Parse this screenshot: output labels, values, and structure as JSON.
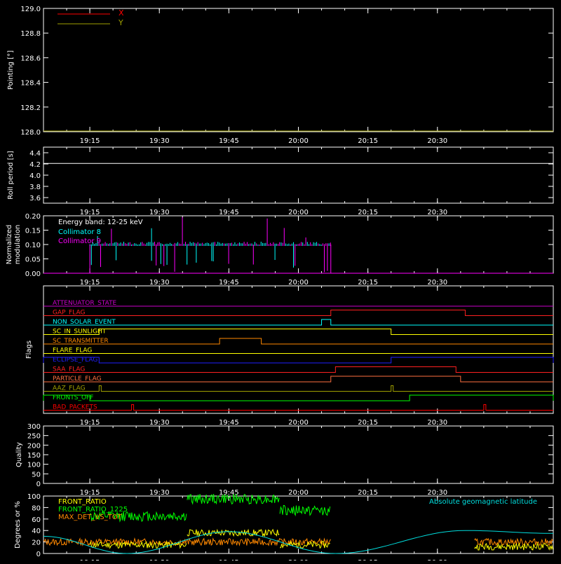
{
  "colors": {
    "background": "#000000",
    "axes": "#ffffff",
    "x": "#ff0000",
    "y": "#a0a000",
    "roll": "#ffffff",
    "collimator8": "#00ffff",
    "collimator9": "#ff00ff",
    "front_ratio": "#ffff00",
    "front_ratio_1225": "#00ff00",
    "max_det": "#ff8800",
    "geomag": "#00dddd"
  },
  "time_ticks": [
    "19:15",
    "19:30",
    "19:45",
    "20:00",
    "20:15",
    "20:30"
  ],
  "chart_data": [
    {
      "type": "line",
      "panel": "pointing",
      "ylabel": "Pointing [°]",
      "ylim": [
        128.0,
        129.0
      ],
      "yticks": [
        "128.0",
        "128.2",
        "128.4",
        "128.6",
        "128.8",
        "129.0"
      ],
      "legend": "top-left",
      "series": [
        {
          "name": "X",
          "values": []
        },
        {
          "name": "Y",
          "values": []
        }
      ]
    },
    {
      "type": "line",
      "panel": "roll",
      "ylabel": "Roll period [s]",
      "ylim": [
        3.5,
        4.5
      ],
      "yticks": [
        "3.6",
        "3.8",
        "4.0",
        "4.2",
        "4.4"
      ],
      "series": [
        {
          "name": "",
          "x": [
            "19:05",
            "20:55"
          ],
          "values": [
            4.21,
            4.21
          ]
        }
      ]
    },
    {
      "type": "line",
      "panel": "modulation",
      "ylabel": "Normalized modulation",
      "ylim": [
        0.0,
        0.2
      ],
      "yticks": [
        "0.00",
        "0.05",
        "0.10",
        "0.15",
        "0.20"
      ],
      "annotation": "Energy band: 12-25 keV",
      "active_range": [
        "19:15",
        "20:07"
      ],
      "series": [
        {
          "name": "Collimator 8",
          "level": 0.1
        },
        {
          "name": "Collimator 9",
          "level": 0.1
        }
      ]
    },
    {
      "type": "line",
      "panel": "flags",
      "ylabel": "Flags",
      "flags": [
        {
          "name": "ATTENUATOR_STATE",
          "color": "#cc00cc",
          "high": []
        },
        {
          "name": "GAP_FLAG",
          "color": "#ff2020",
          "high": [
            [
              "20:07",
              "20:36"
            ]
          ]
        },
        {
          "name": "NON_SOLAR_EVENT",
          "color": "#00ffff",
          "high": [
            [
              "20:05",
              "20:07"
            ]
          ]
        },
        {
          "name": "SC_IN_SUNLIGHT",
          "color": "#ffff00",
          "high": [
            [
              "19:17",
              "20:20"
            ]
          ]
        },
        {
          "name": "SC_TRANSMITTER",
          "color": "#ff8800",
          "high": [
            [
              "19:43",
              "19:52"
            ]
          ]
        },
        {
          "name": "FLARE_FLAG",
          "color": "#ffff00",
          "high": []
        },
        {
          "name": "ECLIPSE_FLAG",
          "color": "#2020ff",
          "high": [
            [
              "19:05",
              "19:17"
            ],
            [
              "20:20",
              "20:55"
            ]
          ]
        },
        {
          "name": "SAA_FLAG",
          "color": "#ff2020",
          "high": [
            [
              "20:08",
              "20:34"
            ]
          ]
        },
        {
          "name": "PARTICLE_FLAG",
          "color": "#ff7040",
          "high": [
            [
              "20:07",
              "20:35"
            ]
          ]
        },
        {
          "name": "AAZ_FLAG",
          "color": "#a0a000",
          "high": [
            [
              "19:17",
              "19:17"
            ],
            [
              "20:20",
              "20:20"
            ]
          ]
        },
        {
          "name": "FRONTS_OFF",
          "color": "#00ff00",
          "high": [
            [
              "19:05",
              "19:15"
            ],
            [
              "20:24",
              "20:55"
            ]
          ]
        },
        {
          "name": "BAD_PACKETS",
          "color": "#ff0000",
          "high": [
            [
              "19:24",
              "19:24"
            ],
            [
              "20:40",
              "20:40"
            ]
          ]
        }
      ]
    },
    {
      "type": "line",
      "panel": "quality",
      "ylabel": "Quality",
      "ylim": [
        0,
        300
      ],
      "yticks": [
        "0",
        "50",
        "100",
        "150",
        "200",
        "250",
        "300"
      ],
      "series": []
    },
    {
      "type": "line",
      "panel": "ratios",
      "ylabel": "Degrees or %",
      "ylim": [
        0,
        100
      ],
      "yticks": [
        "0",
        "20",
        "40",
        "60",
        "80",
        "100"
      ],
      "series": [
        {
          "name": "FRONT_RATIO",
          "segments": [
            [
              "19:15",
              "19:36",
              15
            ],
            [
              "19:36",
              "19:56",
              36
            ],
            [
              "19:56",
              "20:07",
              15
            ],
            [
              "20:38",
              "20:55",
              12
            ]
          ]
        },
        {
          "name": "FRONT_RATIO_1225",
          "segments": [
            [
              "19:15",
              "19:36",
              65
            ],
            [
              "19:36",
              "19:56",
              95
            ],
            [
              "19:56",
              "20:07",
              75
            ]
          ]
        },
        {
          "name": "MAX_DET_VS_TOT",
          "segments": [
            [
              "19:05",
              "20:07",
              20
            ],
            [
              "20:38",
              "20:55",
              20
            ]
          ]
        },
        {
          "name": "Absolute geomagnetic latitude",
          "x": [
            "19:05",
            "19:23",
            "19:45",
            "20:08",
            "20:36",
            "20:55"
          ],
          "values": [
            30,
            0,
            38,
            0,
            40,
            35
          ]
        }
      ]
    }
  ]
}
